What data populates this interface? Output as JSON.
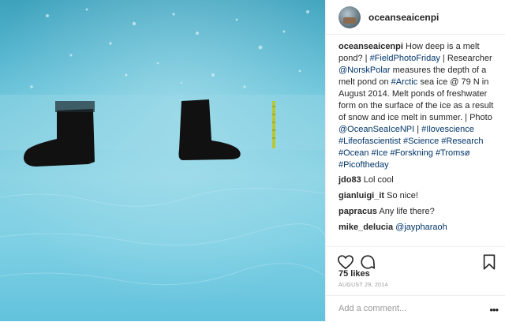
{
  "post": {
    "username": "oceanseaicenpi",
    "caption_parts": [
      {
        "text": "How deep is a melt pond? | ",
        "type": "text"
      },
      {
        "text": "#FieldPhotoFriday",
        "type": "link"
      },
      {
        "text": " | Researcher ",
        "type": "text"
      },
      {
        "text": "@NorskPolar",
        "type": "link"
      },
      {
        "text": " measures the depth of a melt pond on ",
        "type": "text"
      },
      {
        "text": "#Arctic",
        "type": "link"
      },
      {
        "text": " sea ice @ 79 N in August 2014. Melt ponds of freshwater form on the surface of the ice as a result of snow and ice melt in summer. | Photo ",
        "type": "text"
      },
      {
        "text": "@OceanSeaIceNPI",
        "type": "link"
      },
      {
        "text": " | ",
        "type": "text"
      },
      {
        "text": "#Ilovescience",
        "type": "link"
      },
      {
        "text": " ",
        "type": "text"
      },
      {
        "text": "#Lifeofascientist",
        "type": "link"
      },
      {
        "text": " ",
        "type": "text"
      },
      {
        "text": "#Science",
        "type": "link"
      },
      {
        "text": " ",
        "type": "text"
      },
      {
        "text": "#Research",
        "type": "link"
      },
      {
        "text": " ",
        "type": "text"
      },
      {
        "text": "#Ocean",
        "type": "link"
      },
      {
        "text": " ",
        "type": "text"
      },
      {
        "text": "#Ice",
        "type": "link"
      },
      {
        "text": " ",
        "type": "text"
      },
      {
        "text": "#Forskning",
        "type": "link"
      },
      {
        "text": " ",
        "type": "text"
      },
      {
        "text": "#Tromsø",
        "type": "link"
      },
      {
        "text": " ",
        "type": "text"
      },
      {
        "text": "#Picoftheday",
        "type": "link"
      }
    ],
    "comments": [
      {
        "user": "jdo83",
        "text": "Lol cool",
        "link": ""
      },
      {
        "user": "gianluigi_it",
        "text": "So nice!",
        "link": ""
      },
      {
        "user": "papracus",
        "text": "Any life there?",
        "link": ""
      },
      {
        "user": "mike_delucia",
        "text": "",
        "link": "@jaypharaoh"
      }
    ],
    "likes": "75 likes",
    "date": "AUGUST 29, 2014",
    "add_comment_placeholder": "Add a comment...",
    "more_label": "•••"
  },
  "icons": {
    "like": "heart-icon",
    "comment": "comment-icon",
    "save": "bookmark-icon"
  }
}
